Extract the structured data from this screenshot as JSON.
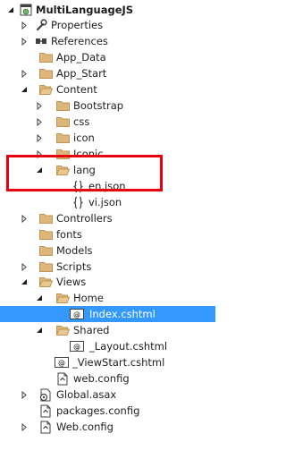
{
  "tree": {
    "items": [
      {
        "label": "MultiLanguageJS",
        "icon": "project-icon",
        "expanded": true,
        "bold": true
      },
      {
        "label": "Properties",
        "icon": "wrench-icon",
        "expanded": false
      },
      {
        "label": "References",
        "icon": "references-icon",
        "expanded": false
      },
      {
        "label": "App_Data",
        "icon": "folder-icon",
        "expanded": null
      },
      {
        "label": "App_Start",
        "icon": "folder-icon",
        "expanded": false
      },
      {
        "label": "Content",
        "icon": "folder-icon",
        "expanded": true
      },
      {
        "label": "Bootstrap",
        "icon": "folder-icon",
        "expanded": false
      },
      {
        "label": "css",
        "icon": "folder-icon",
        "expanded": false
      },
      {
        "label": "icon",
        "icon": "folder-icon",
        "expanded": false
      },
      {
        "label": "Iconic",
        "icon": "folder-icon",
        "expanded": false
      },
      {
        "label": "lang",
        "icon": "folder-icon",
        "expanded": true
      },
      {
        "label": "en.json",
        "icon": "json-file-icon",
        "expanded": null
      },
      {
        "label": "vi.json",
        "icon": "json-file-icon",
        "expanded": null
      },
      {
        "label": "Controllers",
        "icon": "folder-icon",
        "expanded": false
      },
      {
        "label": "fonts",
        "icon": "folder-icon",
        "expanded": null
      },
      {
        "label": "Models",
        "icon": "folder-icon",
        "expanded": null
      },
      {
        "label": "Scripts",
        "icon": "folder-icon",
        "expanded": false
      },
      {
        "label": "Views",
        "icon": "folder-icon",
        "expanded": true
      },
      {
        "label": "Home",
        "icon": "folder-icon",
        "expanded": true
      },
      {
        "label": "Index.cshtml",
        "icon": "razor-file-icon",
        "expanded": null,
        "selected": true
      },
      {
        "label": "Shared",
        "icon": "folder-icon",
        "expanded": true
      },
      {
        "label": "_Layout.cshtml",
        "icon": "razor-file-icon",
        "expanded": null
      },
      {
        "label": "_ViewStart.cshtml",
        "icon": "razor-file-icon",
        "expanded": null
      },
      {
        "label": "web.config",
        "icon": "config-file-icon",
        "expanded": null
      },
      {
        "label": "Global.asax",
        "icon": "global-asax-icon",
        "expanded": false
      },
      {
        "label": "packages.config",
        "icon": "config-file-icon",
        "expanded": null
      },
      {
        "label": "Web.config",
        "icon": "config-file-icon",
        "expanded": false
      }
    ]
  },
  "annotation": {
    "highlight_color": "#e8000f",
    "highlighted_items": [
      "lang",
      "en.json",
      "vi.json"
    ]
  },
  "colors": {
    "folder": "#dcb67a",
    "selection": "#3399ff",
    "text": "#1e1e1e"
  }
}
